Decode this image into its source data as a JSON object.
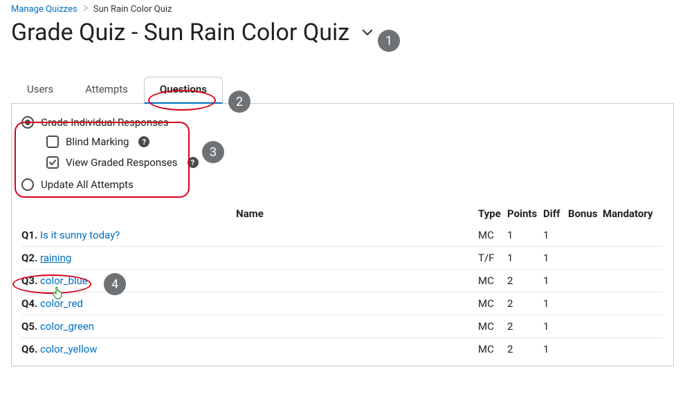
{
  "breadcrumb": {
    "root": "Manage Quizzes",
    "current": "Sun Rain Color Quiz"
  },
  "page_title": "Grade Quiz - Sun Rain Color Quiz",
  "tabs": {
    "users": "Users",
    "attempts": "Attempts",
    "questions": "Questions"
  },
  "options": {
    "grade_individual": "Grade Individual Responses",
    "blind_marking": "Blind Marking",
    "view_graded": "View Graded Responses",
    "update_all": "Update All Attempts"
  },
  "columns": {
    "name": "Name",
    "type": "Type",
    "points": "Points",
    "diff": "Diff",
    "bonus": "Bonus",
    "mandatory": "Mandatory"
  },
  "questions": [
    {
      "num": "Q1.",
      "name": "Is it sunny today?",
      "type": "MC",
      "points": "1",
      "diff": "1",
      "bonus": "",
      "mandatory": ""
    },
    {
      "num": "Q2.",
      "name": "raining",
      "type": "T/F",
      "points": "1",
      "diff": "1",
      "bonus": "",
      "mandatory": ""
    },
    {
      "num": "Q3.",
      "name": "color_blue",
      "type": "MC",
      "points": "2",
      "diff": "1",
      "bonus": "",
      "mandatory": ""
    },
    {
      "num": "Q4.",
      "name": "color_red",
      "type": "MC",
      "points": "2",
      "diff": "1",
      "bonus": "",
      "mandatory": ""
    },
    {
      "num": "Q5.",
      "name": "color_green",
      "type": "MC",
      "points": "2",
      "diff": "1",
      "bonus": "",
      "mandatory": ""
    },
    {
      "num": "Q6.",
      "name": "color_yellow",
      "type": "MC",
      "points": "2",
      "diff": "1",
      "bonus": "",
      "mandatory": ""
    }
  ],
  "callouts": {
    "1": "1",
    "2": "2",
    "3": "3",
    "4": "4"
  }
}
